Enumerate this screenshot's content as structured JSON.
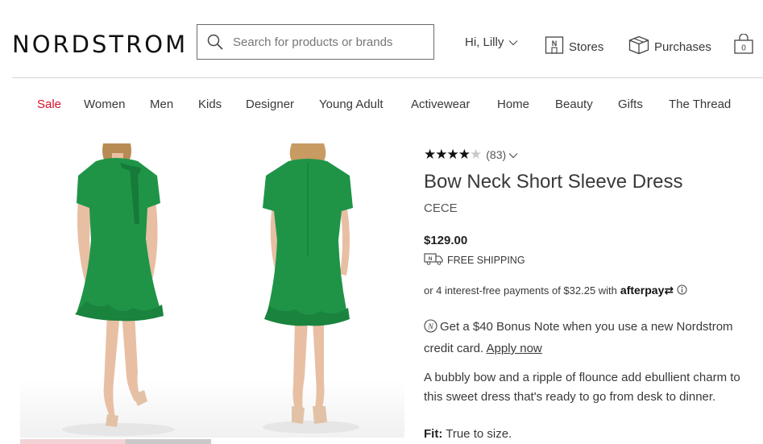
{
  "header": {
    "logo": "NORDSTROM",
    "search_placeholder": "Search for products or brands",
    "greeting": "Hi, Lilly",
    "stores_label": "Stores",
    "purchases_label": "Purchases",
    "bag_count": "0"
  },
  "nav": [
    "Sale",
    "Women",
    "Men",
    "Kids",
    "Designer",
    "Young Adult",
    "Activewear",
    "Home",
    "Beauty",
    "Gifts",
    "The Thread"
  ],
  "product": {
    "rating": 4,
    "review_count": "(83)",
    "title": "Bow Neck Short Sleeve Dress",
    "brand": "CECE",
    "price": "$129.00",
    "shipping": "FREE SHIPPING",
    "installments": "or 4 interest-free payments of $32.25 with",
    "afterpay_label": "afterpay",
    "bonus_text": "Get a $40 Bonus Note when you use a new Nordstrom credit card.",
    "apply_link": "Apply now",
    "description": "A bubbly bow and a ripple of flounce add ebullient charm to this sweet dress that's ready to go from desk to dinner.",
    "fit_label": "Fit:",
    "fit_value": "True to size."
  },
  "colors": {
    "dress_green": "#1f9447",
    "sale_red": "#d6122a"
  }
}
